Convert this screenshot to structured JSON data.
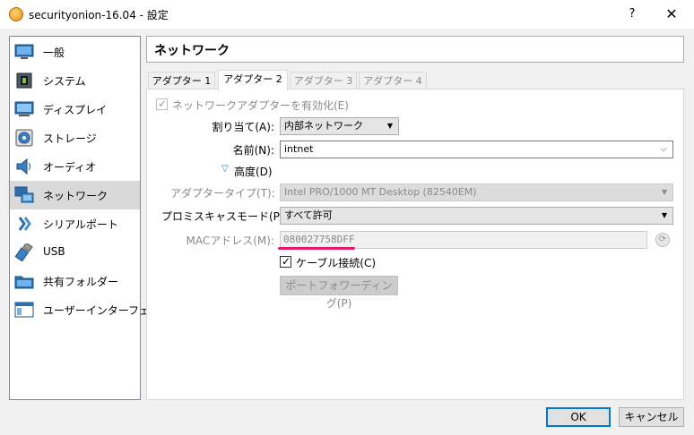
{
  "window": {
    "title": "securityonion-16.04 - 設定",
    "help_label": "?",
    "close_label": "✕"
  },
  "sidebar": {
    "items": [
      {
        "label": "一般",
        "icon": "monitor-icon"
      },
      {
        "label": "システム",
        "icon": "chip-icon"
      },
      {
        "label": "ディスプレイ",
        "icon": "display-icon"
      },
      {
        "label": "ストレージ",
        "icon": "disk-icon"
      },
      {
        "label": "オーディオ",
        "icon": "speaker-icon"
      },
      {
        "label": "ネットワーク",
        "icon": "network-icon",
        "selected": true
      },
      {
        "label": "シリアルポート",
        "icon": "serial-port-icon"
      },
      {
        "label": "USB",
        "icon": "usb-icon"
      },
      {
        "label": "共有フォルダー",
        "icon": "folder-icon"
      },
      {
        "label": "ユーザーインターフェース",
        "icon": "ui-icon"
      }
    ]
  },
  "main": {
    "heading": "ネットワーク",
    "tabs": [
      {
        "label": "アダプター 1",
        "enabled": true
      },
      {
        "label": "アダプター 2",
        "enabled": true,
        "active": true
      },
      {
        "label": "アダプター 3",
        "enabled": false
      },
      {
        "label": "アダプター 4",
        "enabled": false
      }
    ],
    "enable_adapter": {
      "label": "ネットワークアダプターを有効化(E)",
      "checked": true,
      "enabled": false
    },
    "attached_to": {
      "label": "割り当て(A):",
      "value": "内部ネットワーク"
    },
    "name": {
      "label": "名前(N):",
      "value": "intnet"
    },
    "advanced": {
      "label": "高度(D)"
    },
    "adapter_type": {
      "label": "アダプタータイプ(T):",
      "value": "Intel PRO/1000 MT Desktop (82540EM)"
    },
    "promiscuous": {
      "label": "プロミスキャスモード(P):",
      "value": "すべて許可"
    },
    "mac_address": {
      "label": "MACアドレス(M):",
      "value": "080027758DFF"
    },
    "cable_connected": {
      "label": "ケーブル接続(C)",
      "checked": true
    },
    "port_forwarding": {
      "label": "ポートフォワーディング(P)"
    }
  },
  "footer": {
    "ok_label": "OK",
    "cancel_label": "キャンセル"
  },
  "colors": {
    "accent": "#0078d7",
    "annotation_underline": "#e8196c",
    "selection_bg": "#d9d9d9"
  }
}
